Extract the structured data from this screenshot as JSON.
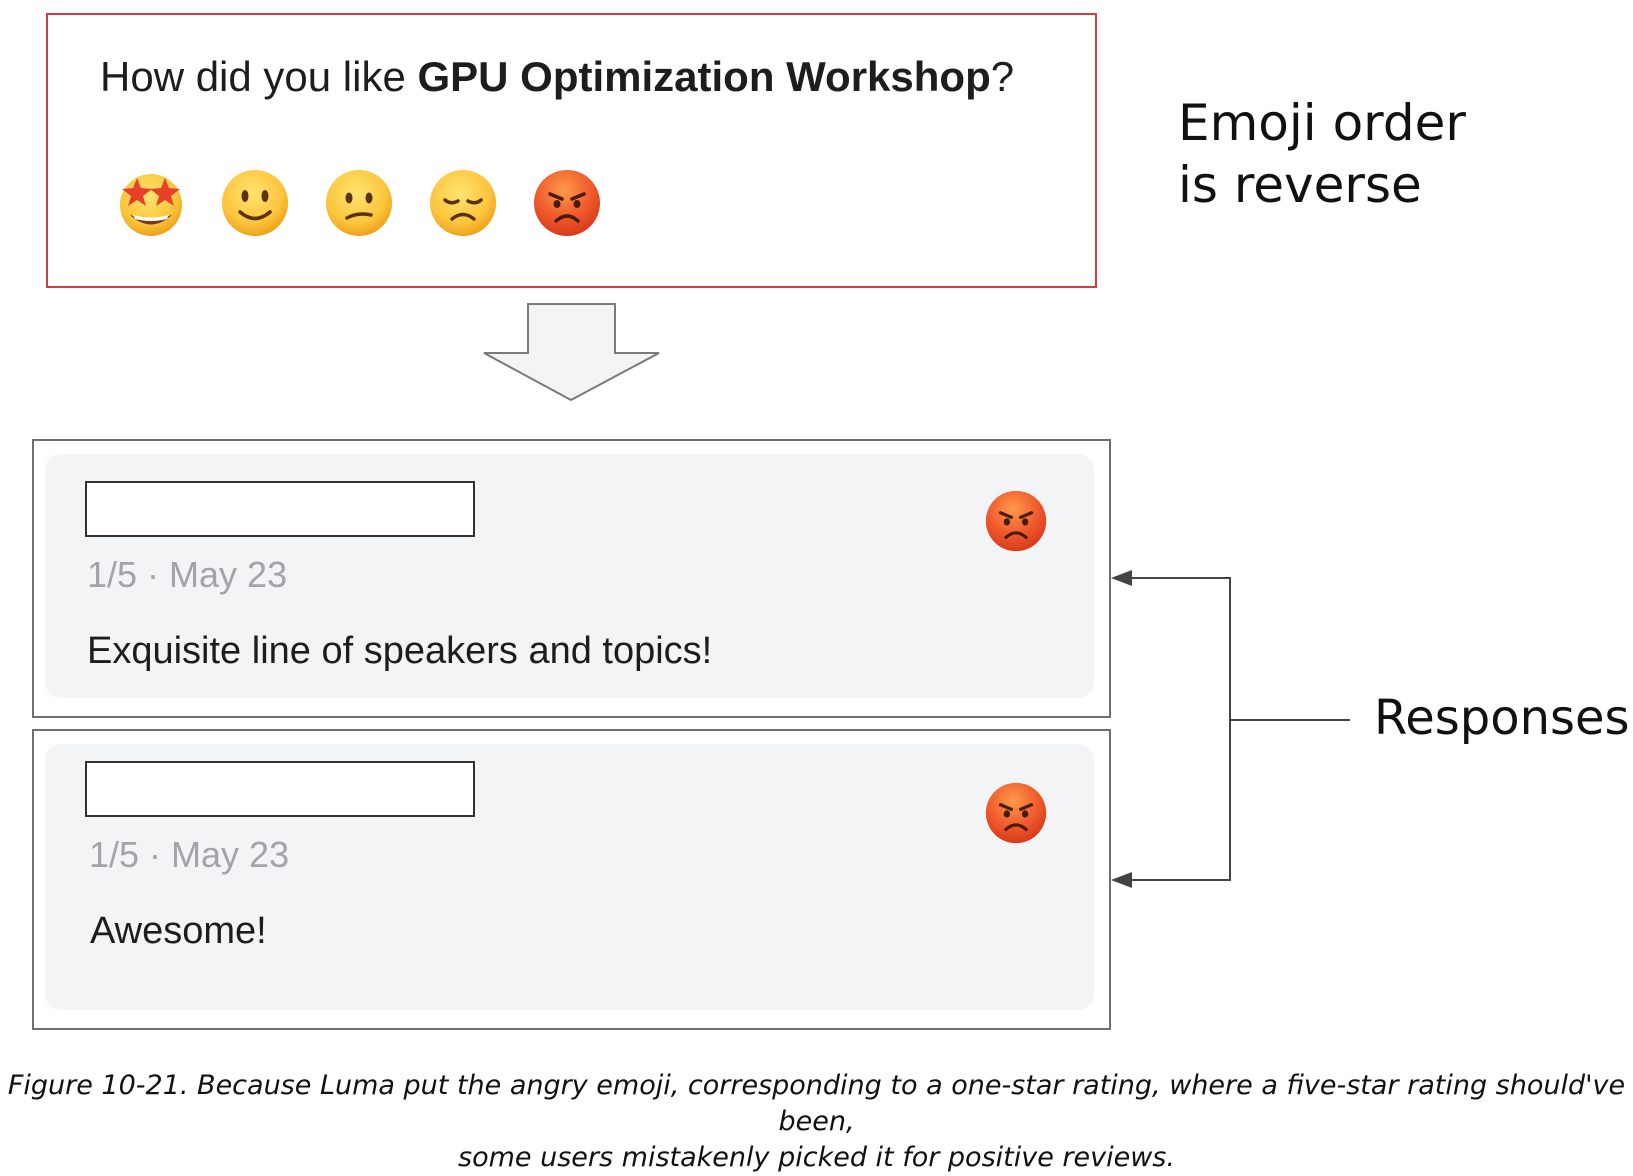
{
  "survey": {
    "question_prefix": "How did you like ",
    "event_name": "GPU Optimization Workshop",
    "question_suffix": "?",
    "emoji_options": [
      "star-struck",
      "slightly-smiling",
      "confused",
      "disappointed",
      "angry"
    ]
  },
  "annotations": {
    "order_note_line1": "Emoji order",
    "order_note_line2": "is reverse",
    "responses_label": "Responses"
  },
  "responses": [
    {
      "rating": "1/5",
      "date": "May 23",
      "meta": "1/5 · May 23",
      "text": "Exquisite line of speakers and topics!",
      "emoji": "angry"
    },
    {
      "rating": "1/5",
      "date": "May 23",
      "meta": "1/5 · May 23",
      "text": "Awesome!",
      "emoji": "angry"
    }
  ],
  "caption": {
    "line1": "Figure 10-21. Because Luma put the angry emoji, corresponding to a one-star rating, where a five-star rating should've been,",
    "line2": "some users mistakenly picked it for positive reviews."
  },
  "colors": {
    "survey_border": "#d83a44",
    "card_background": "#f3f4f6",
    "meta_text": "#a3a3a8",
    "emoji_yellow": "#fcc53b",
    "emoji_angry": "#f05a2c"
  }
}
